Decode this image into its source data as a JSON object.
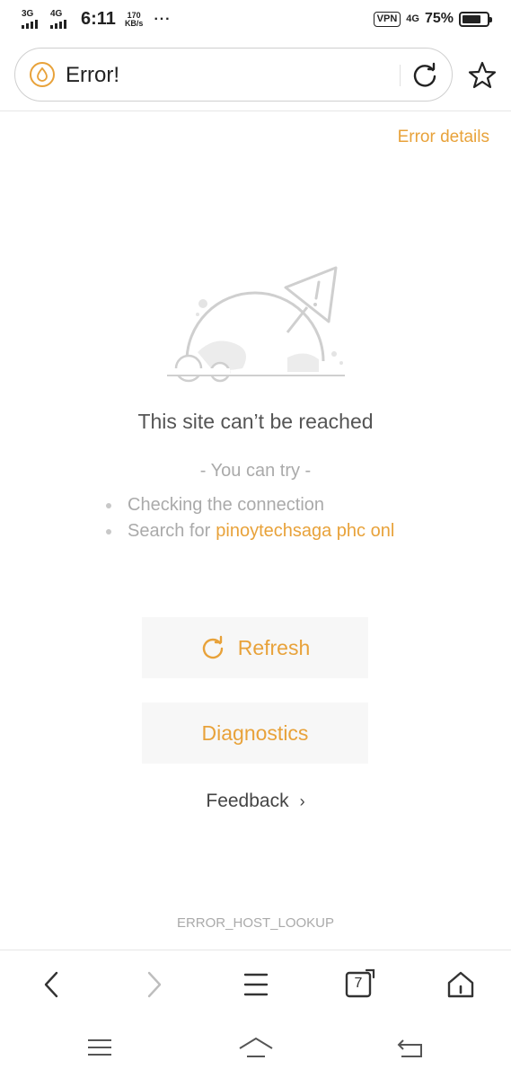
{
  "status_bar": {
    "network1": "3G",
    "network2": "4G",
    "time": "6:11",
    "speed_value": "170",
    "speed_unit": "KB/s",
    "dots": "···",
    "vpn": "VPN",
    "network3": "4G",
    "battery_pct": "75%",
    "battery_level": 0.75
  },
  "address_bar": {
    "title": "Error!"
  },
  "error_details_link": "Error details",
  "error": {
    "title": "This site can’t be reached",
    "try_title": "- You can try -",
    "suggestion_1": "Checking the connection",
    "suggestion_2_prefix": "Search for",
    "suggestion_2_query": "pinoytechsaga phc onl",
    "refresh_label": "Refresh",
    "diagnostics_label": "Diagnostics",
    "feedback_label": "Feedback",
    "feedback_chevron": "›",
    "code": "ERROR_HOST_LOOKUP"
  },
  "bottom_nav": {
    "tab_count": "7"
  },
  "colors": {
    "accent": "#e8a23a",
    "muted_text": "#aaaaaa",
    "button_bg": "#f7f7f7"
  },
  "icons": [
    "signal-icon",
    "vpn-icon",
    "battery-icon",
    "secure-drop-icon",
    "reload-icon",
    "star-icon",
    "refresh-icon",
    "back-icon",
    "forward-icon",
    "menu-icon",
    "tabs-icon",
    "home-icon",
    "system-menu-icon",
    "system-home-icon",
    "system-back-icon"
  ]
}
